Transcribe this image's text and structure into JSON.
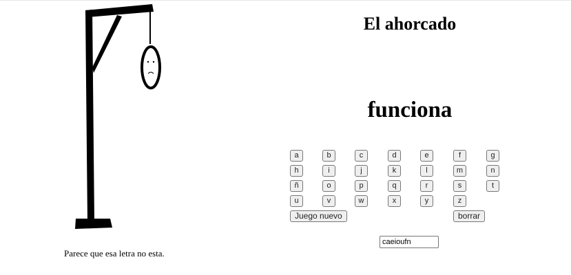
{
  "title": "El ahorcado",
  "word": "funciona",
  "keyboard": {
    "rows": [
      [
        "a",
        "b",
        "c",
        "d",
        "e",
        "f",
        "g"
      ],
      [
        "h",
        "i",
        "j",
        "k",
        "l",
        "m",
        "n"
      ],
      [
        "ñ",
        "o",
        "p",
        "q",
        "r",
        "s",
        "t"
      ],
      [
        "u",
        "v",
        "w",
        "x",
        "y",
        "z"
      ]
    ],
    "new_game_label": "Juego nuevo",
    "delete_label": "borrar"
  },
  "guessed_input": {
    "value": "caeioufn"
  },
  "message": "Parece que esa letra no esta.",
  "colors": {
    "background": "#ffffff",
    "drawing": "#000000",
    "button_bg": "#efefef",
    "button_border": "#767676"
  }
}
